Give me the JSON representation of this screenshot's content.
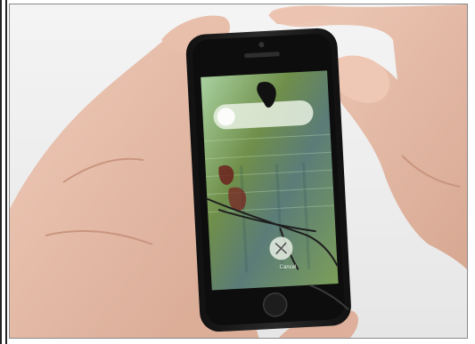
{
  "photo": {
    "subject": "smartphone-held-in-two-hands",
    "screen": {
      "cancel_label": "Cancel"
    },
    "colors": {
      "background": "#f0f0f0",
      "skin": "#e3b9a6",
      "phone_body": "#1a1a1a",
      "screen_tint": "#6f8f5a"
    }
  }
}
